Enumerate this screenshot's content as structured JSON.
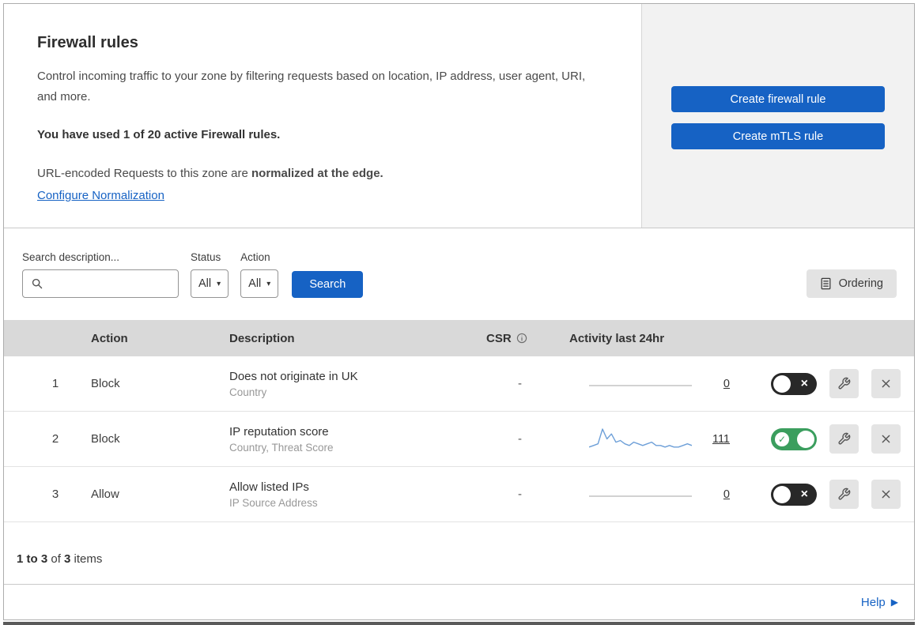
{
  "header": {
    "title": "Firewall rules",
    "description": "Control incoming traffic to your zone by filtering requests based on location, IP address, user agent, URI, and more.",
    "usage_text": "You have used 1 of 20 active Firewall rules.",
    "normalization_text": "URL-encoded Requests to this zone are ",
    "normalization_bold": "normalized at the edge.",
    "normalization_link": "Configure Normalization"
  },
  "actions": {
    "create_firewall_rule": "Create firewall rule",
    "create_mtls_rule": "Create mTLS rule"
  },
  "filters": {
    "search_label": "Search description...",
    "status_label": "Status",
    "status_value": "All",
    "action_label": "Action",
    "action_value": "All",
    "search_button": "Search",
    "ordering_button": "Ordering"
  },
  "table": {
    "columns": {
      "action": "Action",
      "description": "Description",
      "csr": "CSR",
      "activity": "Activity last 24hr"
    },
    "rows": [
      {
        "priority": "1",
        "action": "Block",
        "description": "Does not originate in UK",
        "fields": "Country",
        "csr": "-",
        "activity_count": "0",
        "enabled": false,
        "sparkline": []
      },
      {
        "priority": "2",
        "action": "Block",
        "description": "IP reputation score",
        "fields": "Country, Threat Score",
        "csr": "-",
        "activity_count": "111",
        "enabled": true,
        "sparkline": [
          2,
          3,
          4,
          13,
          7,
          10,
          5,
          6,
          4,
          3,
          5,
          4,
          3,
          4,
          5,
          3,
          3,
          2,
          3,
          2,
          2,
          3,
          4,
          3
        ]
      },
      {
        "priority": "3",
        "action": "Allow",
        "description": "Allow listed IPs",
        "fields": "IP Source Address",
        "csr": "-",
        "activity_count": "0",
        "enabled": false,
        "sparkline": []
      }
    ],
    "footer": {
      "range": "1 to 3",
      "of": " of ",
      "total": "3",
      "items": " items"
    }
  },
  "footer": {
    "help_label": "Help"
  },
  "icons": {
    "dropdown_chevron": "▾",
    "help_arrow": "▶",
    "toggle_check": "✓",
    "toggle_cross": "×"
  },
  "colors": {
    "primary_blue": "#1662c4",
    "toggle_on_green": "#3b9e5e",
    "toggle_off_dark": "#282828",
    "sparkline_blue": "#6d9fd8",
    "sparkline_flat": "#c4c4c4",
    "header_gray": "#d9d9d9"
  }
}
